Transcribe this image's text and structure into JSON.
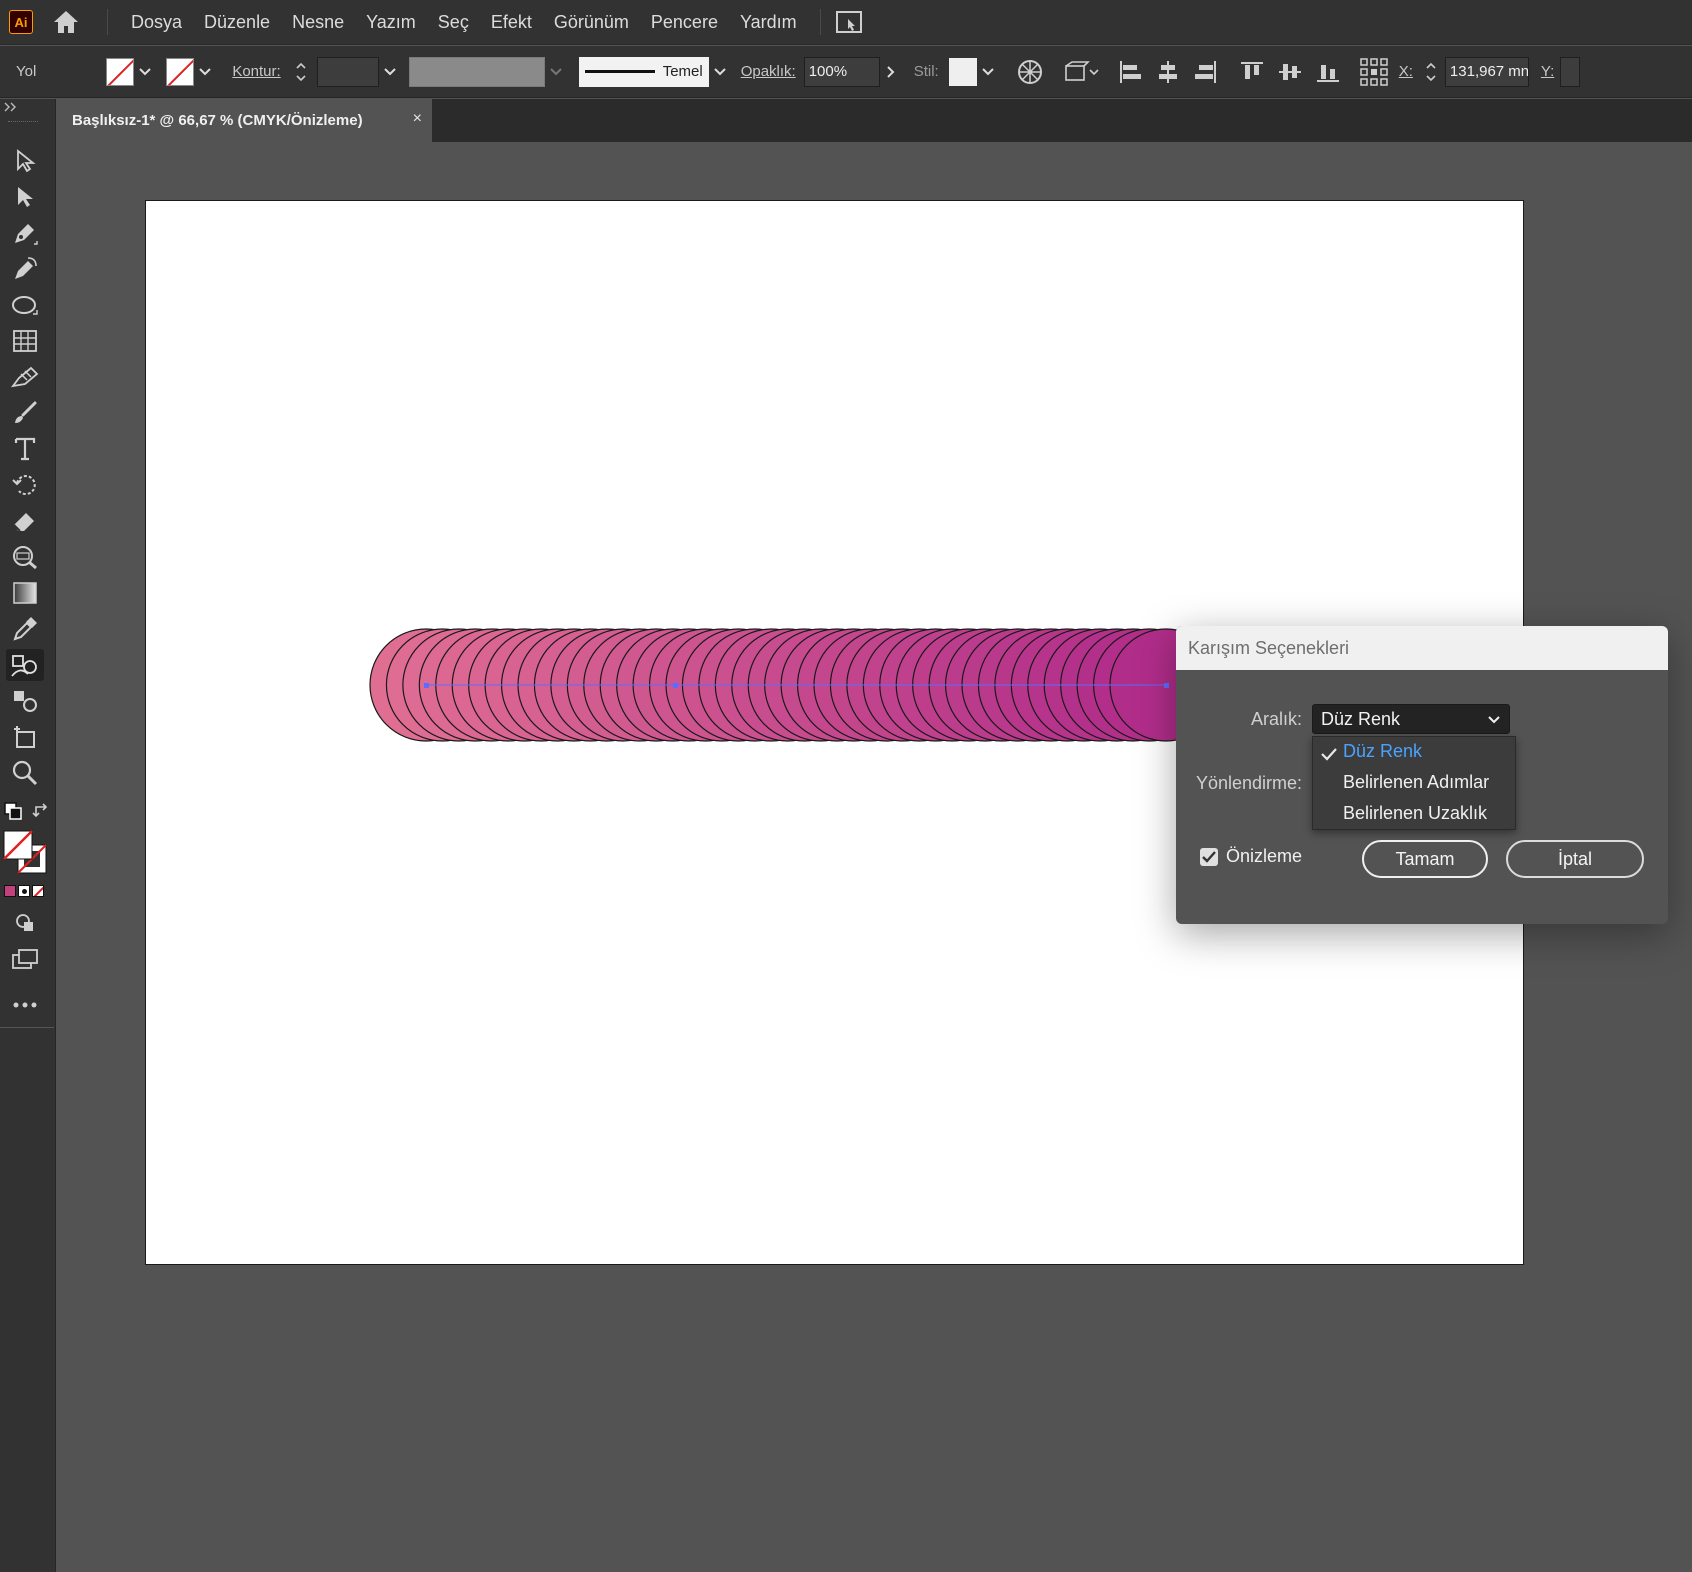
{
  "app": {
    "logo_text": "Ai",
    "brand_color": "#ff9a00"
  },
  "menu": [
    "Dosya",
    "Düzenle",
    "Nesne",
    "Yazım",
    "Seç",
    "Efekt",
    "Görünüm",
    "Pencere",
    "Yardım"
  ],
  "control_bar": {
    "selection_label": "Yol",
    "stroke_label": "Kontur:",
    "brush_label": "Temel",
    "opacity_label": "Opaklık:",
    "opacity_value": "100%",
    "style_label": "Stil:",
    "x_label": "X:",
    "x_value": "131,967 mn",
    "y_label": "Y:"
  },
  "document_tab": {
    "title": "Başlıksız-1* @ 66,67 % (CMYK/Önizleme)",
    "close": "×"
  },
  "canvas": {
    "blend_start_color": "#e06e93",
    "blend_end_color": "#b12d8a",
    "blend_step_count": 46
  },
  "dialog": {
    "title": "Karışım Seçenekleri",
    "spacing_label": "Aralık:",
    "spacing_value": "Düz Renk",
    "spacing_options": [
      "Düz Renk",
      "Belirlenen Adımlar",
      "Belirlenen Uzaklık"
    ],
    "orientation_label": "Yönlendirme:",
    "preview_label": "Önizleme",
    "preview_checked": true,
    "ok_label": "Tamam",
    "cancel_label": "İptal"
  }
}
